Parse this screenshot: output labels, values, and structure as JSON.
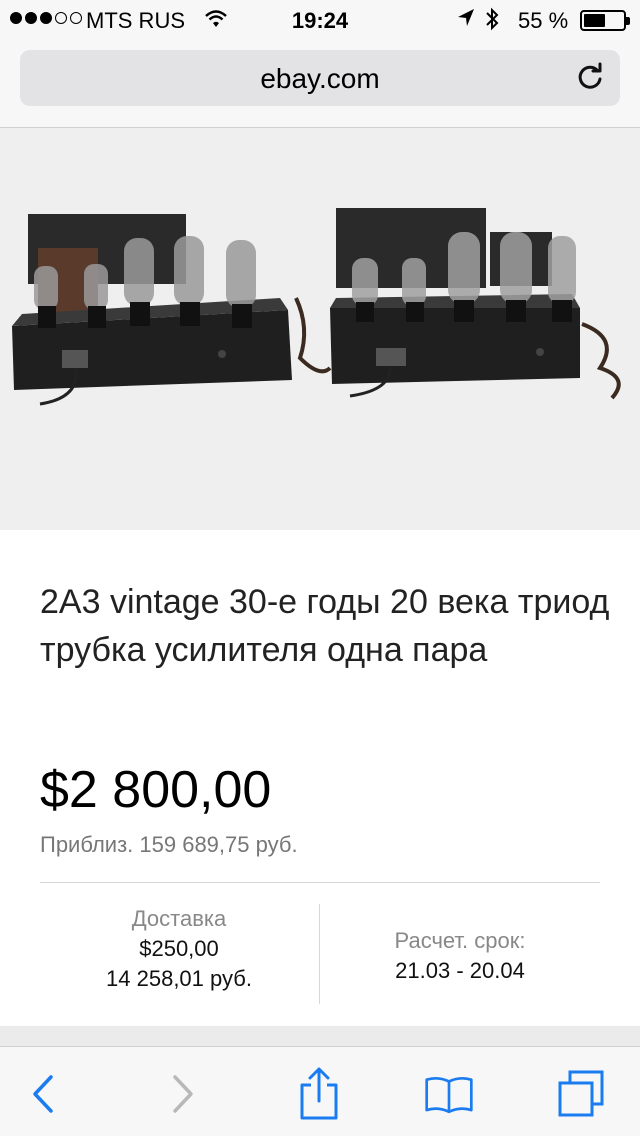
{
  "status_bar": {
    "carrier": "MTS RUS",
    "time": "19:24",
    "battery_percent": "55 %",
    "battery_level": 0.55,
    "signal_bars": 3
  },
  "browser": {
    "url": "ebay.com"
  },
  "product": {
    "title": "2A3 vintage 30-е годы 20 века триод трубка усилителя одна пара",
    "price": "$2 800,00",
    "approx_price": "Приблиз. 159 689,75 руб.",
    "shipping": {
      "label": "Доставка",
      "price_usd": "$250,00",
      "price_rub": "14 258,01 руб."
    },
    "delivery": {
      "label": "Расчет. срок:",
      "dates": "21.03 - 20.04"
    }
  },
  "colors": {
    "accent": "#1a7cf0",
    "disabled": "#b8b8b8"
  },
  "icons": {
    "back": "chevron-left-icon",
    "forward": "chevron-right-icon",
    "share": "share-icon",
    "bookmarks": "book-icon",
    "tabs": "tabs-icon",
    "reload": "reload-icon"
  }
}
